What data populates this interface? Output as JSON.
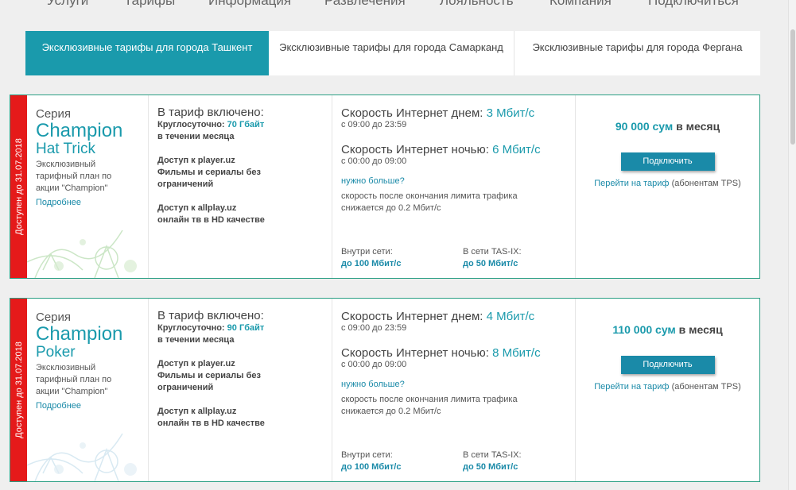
{
  "nav": {
    "items": [
      "Услуги",
      "Тарифы",
      "Информация",
      "Развлечения",
      "Лояльность",
      "Компания",
      "Подключиться"
    ]
  },
  "tabs": [
    {
      "label": "Эксклюзивные тарифы для города Ташкент",
      "active": true
    },
    {
      "label": "Эксклюзивные тарифы для города Самарканд",
      "active": false
    },
    {
      "label": "Эксклюзивные тарифы для города Фергана",
      "active": false
    }
  ],
  "colors": {
    "accent": "#1a9aac",
    "ribbon": "#e51a1a",
    "border": "#2a9f84",
    "link": "#1a8aa8"
  },
  "cards": [
    {
      "ribbon": "Доступен до 31.07.2018",
      "series": "Серия",
      "name": "Champion",
      "subname": "Hat Trick",
      "desc": "Эксклюзивный тарифный план по акции \"Champion\"",
      "more": "Подробнее",
      "incl_title": "В тариф включено:",
      "incl_round": "Круглосуточно:",
      "incl_volume": "70 Гбайт",
      "incl_month": "в течении месяца",
      "player_line1": "Доступ к player.uz",
      "player_line2": "Фильмы и сериалы без",
      "player_line3": "ограничений",
      "allplay_line1": "Доступ к allplay.uz",
      "allplay_line2": "онлайн тв в HD качестве",
      "day_label": "Скорость Интернет днем:",
      "day_speed": "3 Мбит/с",
      "day_time": "с 09:00 до 23:59",
      "night_label": "Скорость Интернет ночью:",
      "night_speed": "6 Мбит/с",
      "night_time": "с 00:00 до 09:00",
      "need_more": "нужно больше?",
      "after_limit": "скорость после окончания лимита трафика снижается до 0.2 Мбит/с",
      "inside_label": "Внутри сети:",
      "inside_value": "до 100 Мбит/с",
      "tasix_label": "В сети TAS-IX:",
      "tasix_value": "до 50 Мбит/с",
      "price_amount": "90 000 сум",
      "price_period": "в месяц",
      "connect": "Подключить",
      "goto_link": "Перейти на тариф",
      "goto_note": "(абонентам TPS)"
    },
    {
      "ribbon": "Доступен до 31.07.2018",
      "series": "Серия",
      "name": "Champion",
      "subname": "Poker",
      "desc": "Эксклюзивный тарифный план по акции \"Champion\"",
      "more": "Подробнее",
      "incl_title": "В тариф включено:",
      "incl_round": "Круглосуточно:",
      "incl_volume": "90 Гбайт",
      "incl_month": "в течении месяца",
      "player_line1": "Доступ к player.uz",
      "player_line2": "Фильмы и сериалы без",
      "player_line3": "ограничений",
      "allplay_line1": "Доступ к allplay.uz",
      "allplay_line2": "онлайн тв в HD качестве",
      "day_label": "Скорость Интернет днем:",
      "day_speed": "4 Мбит/с",
      "day_time": "с 09:00 до 23:59",
      "night_label": "Скорость Интернет ночью:",
      "night_speed": "8 Мбит/с",
      "night_time": "с 00:00 до 09:00",
      "need_more": "нужно больше?",
      "after_limit": "скорость после окончания лимита трафика снижается до 0.2 Мбит/с",
      "inside_label": "Внутри сети:",
      "inside_value": "до 100 Мбит/с",
      "tasix_label": "В сети TAS-IX:",
      "tasix_value": "до 50 Мбит/с",
      "price_amount": "110 000 сум",
      "price_period": "в месяц",
      "connect": "Подключить",
      "goto_link": "Перейти на тариф",
      "goto_note": "(абонентам TPS)"
    }
  ]
}
